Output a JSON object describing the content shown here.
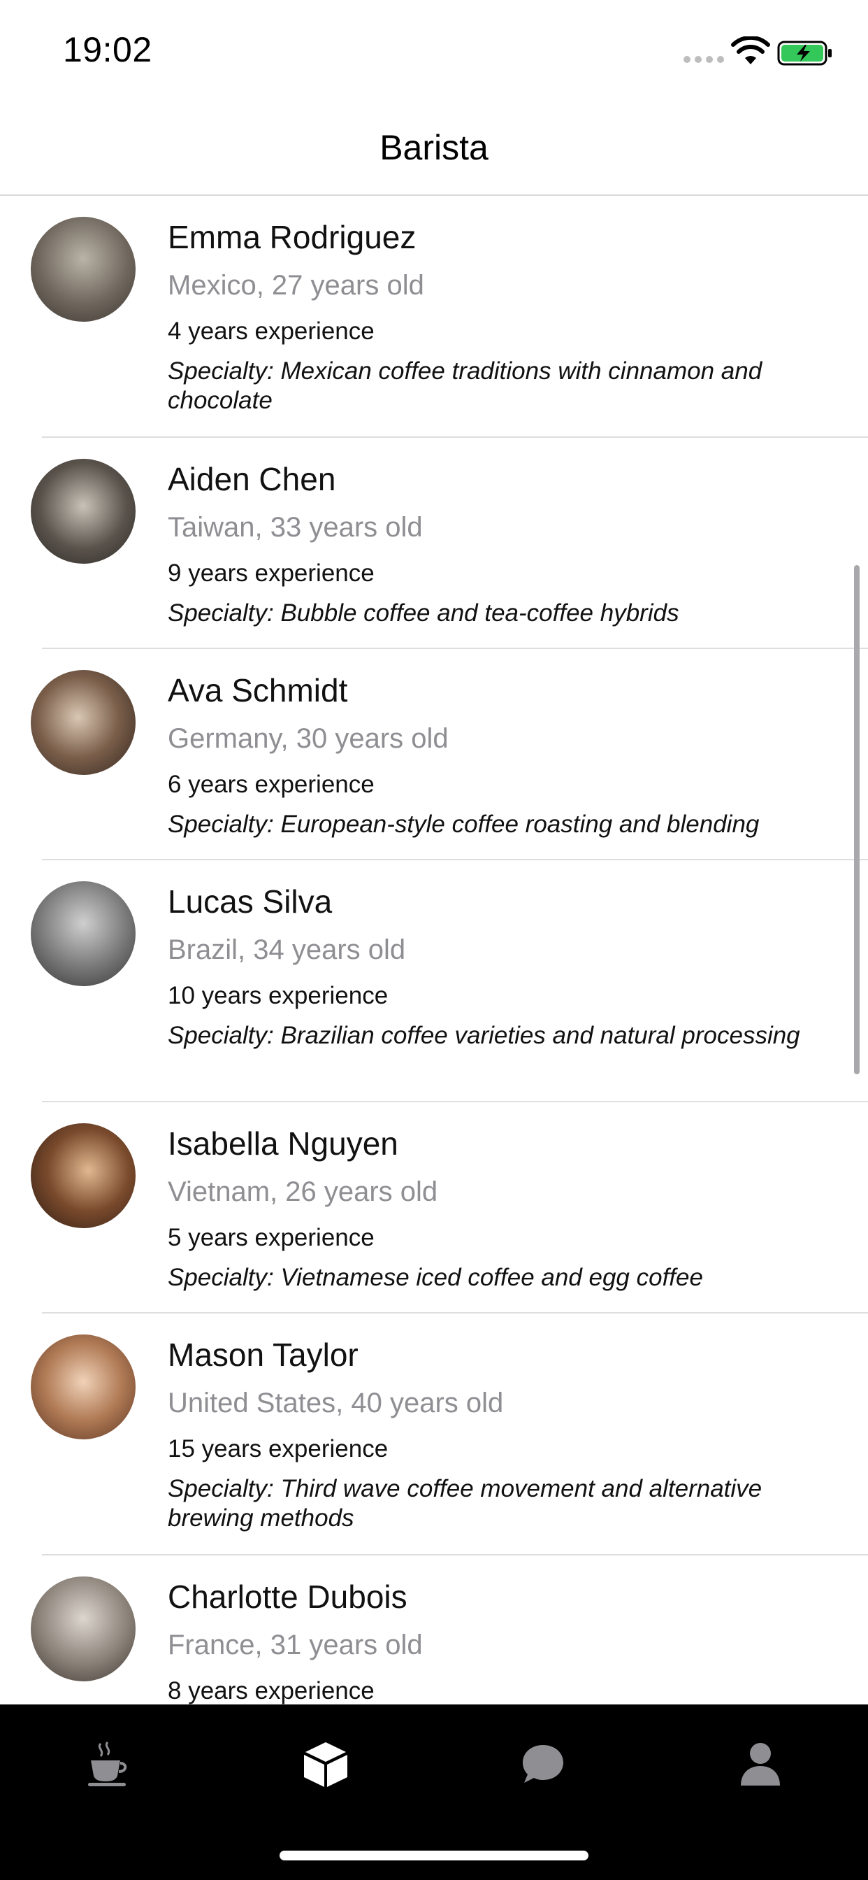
{
  "status": {
    "time": "19:02"
  },
  "header": {
    "title": "Barista"
  },
  "baristas": [
    {
      "name": "Emma Rodriguez",
      "location_age": "Mexico, 27 years old",
      "experience": "4 years experience",
      "specialty": "Specialty: Mexican coffee traditions with cinnamon and chocolate"
    },
    {
      "name": "Aiden Chen",
      "location_age": "Taiwan, 33 years old",
      "experience": "9 years experience",
      "specialty": "Specialty: Bubble coffee and tea-coffee hybrids"
    },
    {
      "name": "Ava Schmidt",
      "location_age": "Germany, 30 years old",
      "experience": "6 years experience",
      "specialty": "Specialty: European-style coffee roasting and blending"
    },
    {
      "name": "Lucas Silva",
      "location_age": "Brazil, 34 years old",
      "experience": "10 years experience",
      "specialty": "Specialty: Brazilian coffee varieties and natural processing"
    },
    {
      "name": "Isabella Nguyen",
      "location_age": "Vietnam, 26 years old",
      "experience": "5 years experience",
      "specialty": "Specialty: Vietnamese iced coffee and egg coffee"
    },
    {
      "name": "Mason Taylor",
      "location_age": "United States, 40 years old",
      "experience": "15 years experience",
      "specialty": "Specialty: Third wave coffee movement and alternative brewing methods"
    },
    {
      "name": "Charlotte Dubois",
      "location_age": "France, 31 years old",
      "experience": "8 years experience",
      "specialty": ""
    }
  ],
  "tabs": [
    {
      "icon": "coffee-cup-icon",
      "active": false
    },
    {
      "icon": "cube-icon",
      "active": true
    },
    {
      "icon": "chat-bubble-icon",
      "active": false
    },
    {
      "icon": "person-icon",
      "active": false
    }
  ],
  "colors": {
    "tab_active": "#ffffff",
    "tab_inactive": "#8e8e93",
    "battery_fill": "#34c759",
    "secondary_text": "#8e8e93"
  }
}
